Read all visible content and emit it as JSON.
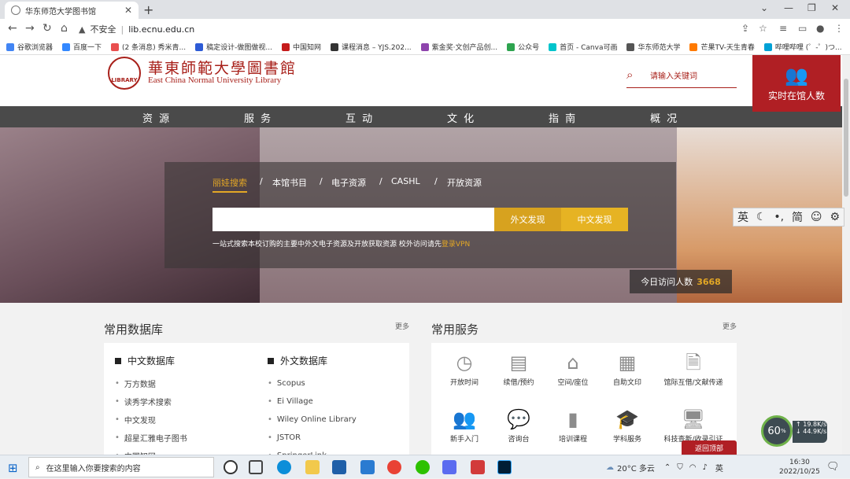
{
  "browser": {
    "tab_title": "华东师范大学图书馆",
    "close_glyph": "✕",
    "newtab_glyph": "+",
    "window_controls": [
      "⌄",
      "—",
      "❐",
      "✕"
    ],
    "security_label": "不安全",
    "url": "lib.ecnu.edu.cn",
    "nav_glyphs": [
      "←",
      "→",
      "↻",
      "⌂"
    ],
    "bookmarks": [
      {
        "label": "谷歌浏览器",
        "color": "#4285f4"
      },
      {
        "label": "百度一下",
        "color": "#3388ff"
      },
      {
        "label": "(2 条消息) 秀米青...",
        "color": "#e94f4f"
      },
      {
        "label": "稿定设计-做图做视...",
        "color": "#2d5bd6"
      },
      {
        "label": "中国知网",
        "color": "#c51b1b"
      },
      {
        "label": "课程消息 – YJS.202...",
        "color": "#333333"
      },
      {
        "label": "紫金奖·文创产品创...",
        "color": "#8e44ad"
      },
      {
        "label": "公众号",
        "color": "#2ea44f"
      },
      {
        "label": "首页 - Canva可画",
        "color": "#00c4cc"
      },
      {
        "label": "华东师范大学",
        "color": "#555555"
      },
      {
        "label": "芒果TV-天生青春",
        "color": "#ff7a00"
      },
      {
        "label": "哔哩哔哩 (゜-゜)つ...",
        "color": "#00a1d6"
      }
    ]
  },
  "header": {
    "logo_cn": "華東師範大學圖書館",
    "logo_en": "East China Normal University Library",
    "seal_text": "LIBRARY",
    "search_placeholder": "请输入关键词",
    "live_count_label": "实时在馆人数"
  },
  "nav": {
    "items": [
      "资 源",
      "服 务",
      "互 动",
      "文 化",
      "指 南",
      "概 况"
    ]
  },
  "hero": {
    "tabs": [
      "丽娃搜索",
      "本馆书目",
      "电子资源",
      "CASHL",
      "开放资源"
    ],
    "tab_separator": "/",
    "btn_foreign": "外文发现",
    "btn_chinese": "中文发现",
    "note_prefix": "一站式搜索本校订购的主要中外文电子资源及开放获取资源 校外访问请先",
    "note_vpn": "登录VPN",
    "visit_label": "今日访问人数",
    "visit_count": "3668",
    "access_tools": [
      "英",
      "☾",
      "•,",
      "简",
      "☺",
      "⚙"
    ]
  },
  "databases": {
    "title": "常用数据库",
    "more": "更多",
    "cn_head": "中文数据库",
    "cn_items": [
      "万方数据",
      "读秀学术搜索",
      "中文发现",
      "超星汇雅电子图书",
      "中国知网"
    ],
    "en_head": "外文数据库",
    "en_items": [
      "Scopus",
      "Ei Village",
      "Wiley Online Library",
      "JSTOR",
      "SpringerLink"
    ]
  },
  "services": {
    "title": "常用服务",
    "more": "更多",
    "items": [
      {
        "label": "开放时间",
        "icon": "clock-icon"
      },
      {
        "label": "续借/预约",
        "icon": "books-icon"
      },
      {
        "label": "空间/座位",
        "icon": "chair-icon"
      },
      {
        "label": "自助文印",
        "icon": "printer-icon"
      },
      {
        "label": "馆际互借/文献传递",
        "icon": "document-icon"
      },
      {
        "label": "新手入门",
        "icon": "users-icon"
      },
      {
        "label": "咨询台",
        "icon": "chat-icon"
      },
      {
        "label": "培训课程",
        "icon": "book-icon"
      },
      {
        "label": "学科服务",
        "icon": "graduation-icon"
      },
      {
        "label": "科技查新/收录引证",
        "icon": "monitor-icon"
      }
    ],
    "back_to_top": "返回顶部"
  },
  "netwidget": {
    "percent": "60",
    "percent_unit": "%",
    "up": "19.8",
    "down": "44.9",
    "unit": "K/s"
  },
  "taskbar": {
    "search_placeholder": "在这里输入你要搜索的内容",
    "weather": "20°C 多云",
    "ime": "英",
    "time": "16:30",
    "date": "2022/10/25"
  }
}
